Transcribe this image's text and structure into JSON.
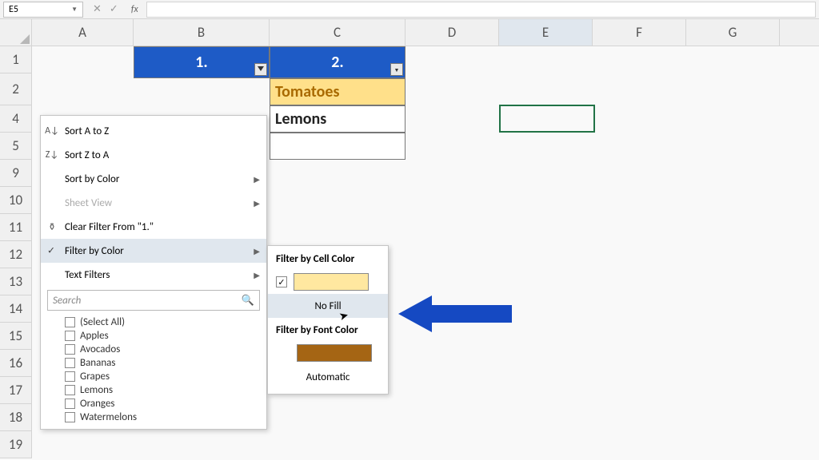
{
  "name_box": {
    "cell_ref": "E5"
  },
  "formula_bar": {
    "fx_label": "fx"
  },
  "columns": [
    "A",
    "B",
    "C",
    "D",
    "E",
    "F",
    "G"
  ],
  "rows": [
    "1",
    "2",
    "4",
    "5",
    "9",
    "10",
    "11",
    "12",
    "13",
    "14",
    "15",
    "16",
    "17",
    "18",
    "19"
  ],
  "table": {
    "header1": "1.",
    "header2": "2.",
    "row1_col2": "Tomatoes",
    "row2_col2": "Lemons"
  },
  "menu": {
    "sort_az": "Sort A to Z",
    "sort_za": "Sort Z to A",
    "sort_color": "Sort by Color",
    "sheet_view": "Sheet View",
    "clear_filter": "Clear Filter From \"1.\"",
    "filter_color": "Filter by Color",
    "text_filters": "Text Filters",
    "search_placeholder": "Search"
  },
  "checklist": [
    "(Select All)",
    "Apples",
    "Avocados",
    "Bananas",
    "Grapes",
    "Lemons",
    "Oranges",
    "Watermelons"
  ],
  "submenu": {
    "cell_color": "Filter by Cell Color",
    "no_fill": "No Fill",
    "font_color": "Filter by Font Color",
    "automatic": "Automatic"
  }
}
